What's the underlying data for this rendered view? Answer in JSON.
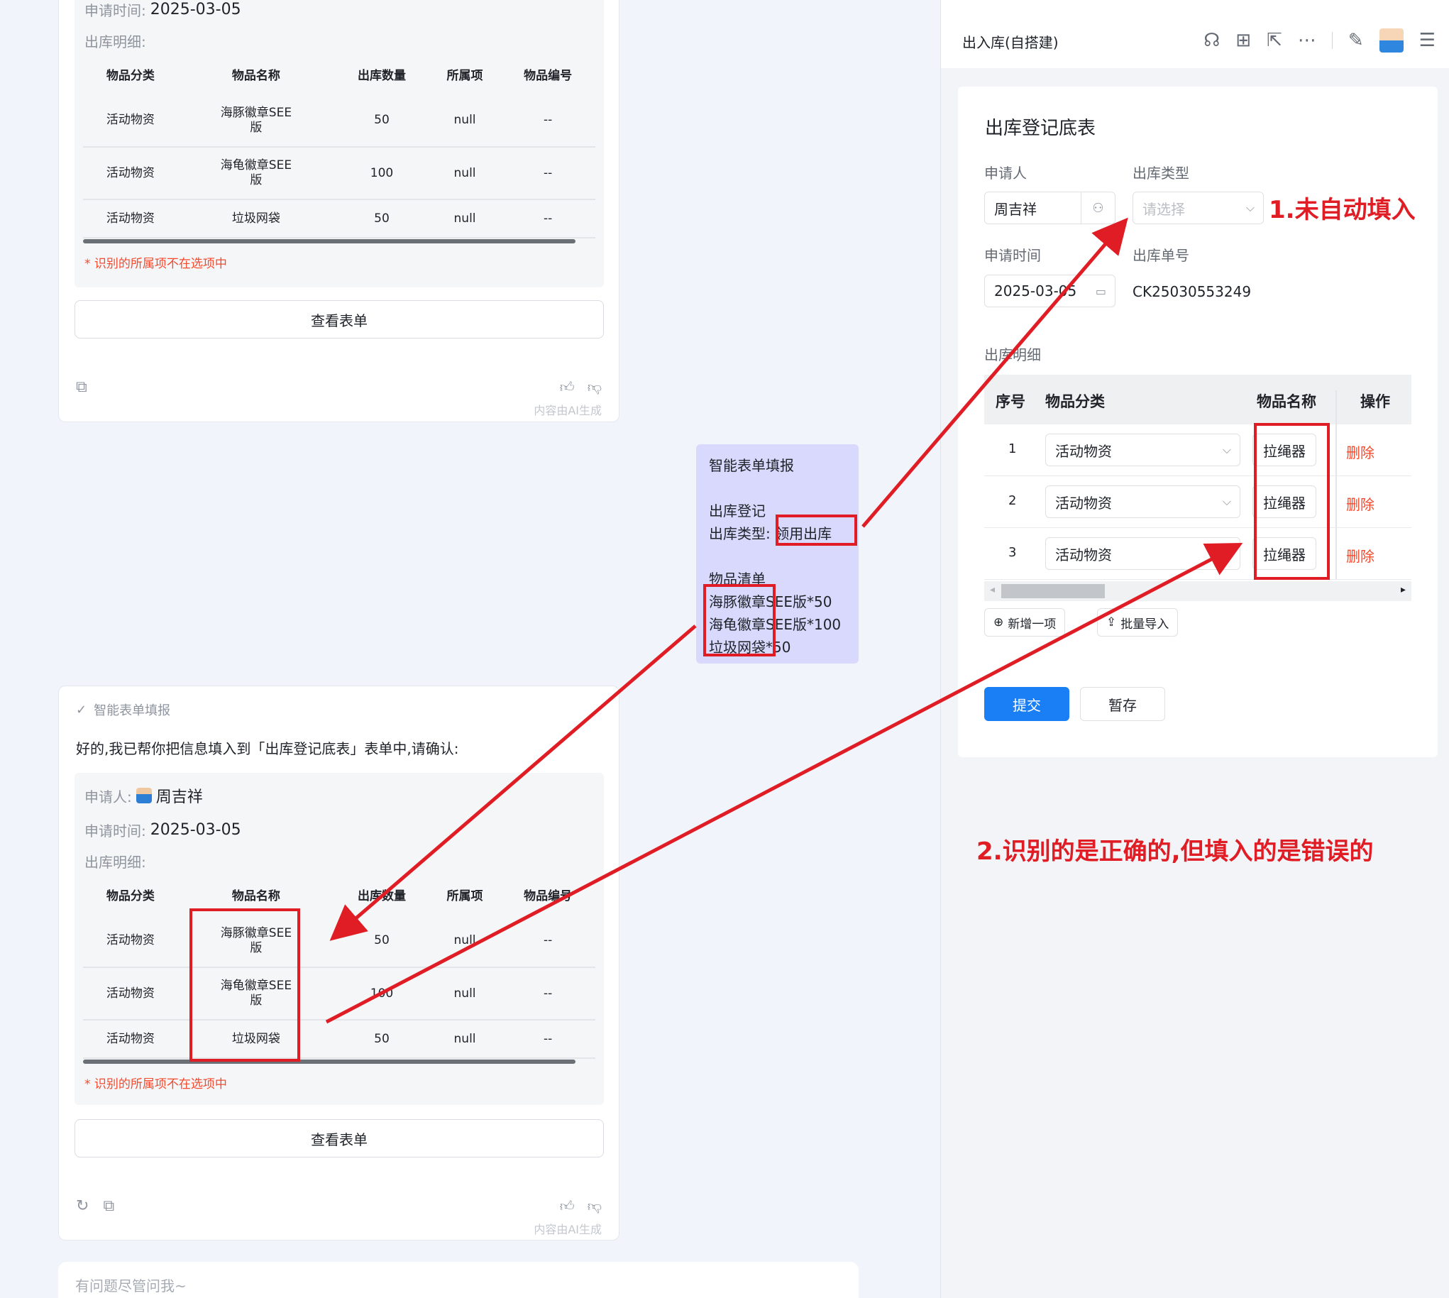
{
  "chat": {
    "card_top": {
      "apply_time_label": "申请时间:",
      "apply_time_value": "2025-03-05",
      "detail_label": "出库明细:",
      "headers": [
        "物品分类",
        "物品名称",
        "出库数量",
        "所属项",
        "物品编号"
      ],
      "rows": [
        [
          "活动物资",
          "海豚徽章SEE版",
          "50",
          "null",
          "--"
        ],
        [
          "活动物资",
          "海龟徽章SEE版",
          "100",
          "null",
          "--"
        ],
        [
          "活动物资",
          "垃圾网袋",
          "50",
          "null",
          "--"
        ]
      ],
      "warning": "* 识别的所属项不在选项中",
      "view_button": "查看表单",
      "ai_note": "内容由AI生成"
    },
    "bubble": {
      "title": "智能表单填报",
      "line_form": "出库登记",
      "line_type_label": "出库类型:",
      "line_type_value": "领用出库",
      "items_label": "物品清单",
      "items": [
        "海豚徽章SEE版*50",
        "海龟徽章SEE版*100",
        "垃圾网袋*50"
      ]
    },
    "card_bottom": {
      "head": "智能表单填报",
      "message": "好的,我已帮你把信息填入到「出库登记底表」表单中,请确认:",
      "applicant_label": "申请人:",
      "applicant_value": "周吉祥",
      "apply_time_label": "申请时间:",
      "apply_time_value": "2025-03-05",
      "detail_label": "出库明细:",
      "headers": [
        "物品分类",
        "物品名称",
        "出库数量",
        "所属项",
        "物品编号"
      ],
      "rows": [
        [
          "活动物资",
          "海豚徽章SEE版",
          "50",
          "null",
          "--"
        ],
        [
          "活动物资",
          "海龟徽章SEE版",
          "100",
          "null",
          "--"
        ],
        [
          "活动物资",
          "垃圾网袋",
          "50",
          "null",
          "--"
        ]
      ],
      "warning": "* 识别的所属项不在选项中",
      "view_button": "查看表单",
      "ai_note": "内容由AI生成"
    },
    "input_placeholder": "有问题尽管问我~"
  },
  "panel": {
    "title": "出入库(自搭建)",
    "form_title": "出库登记底表",
    "applicant_label": "申请人",
    "applicant_value": "周吉祥",
    "type_label": "出库类型",
    "type_placeholder": "请选择",
    "time_label": "申请时间",
    "time_value": "2025-03-05",
    "order_label": "出库单号",
    "order_value": "CK25030553249",
    "detail_label": "出库明细",
    "grid_headers": {
      "idx": "序号",
      "category": "物品分类",
      "name": "物品名称",
      "op": "操作"
    },
    "grid_rows": [
      {
        "idx": "1",
        "category": "活动物资",
        "name": "拉绳器",
        "op": "删除"
      },
      {
        "idx": "2",
        "category": "活动物资",
        "name": "拉绳器",
        "op": "删除"
      },
      {
        "idx": "3",
        "category": "活动物资",
        "name": "拉绳器",
        "op": "删除"
      }
    ],
    "add_button": "新增一项",
    "import_button": "批量导入",
    "submit_button": "提交",
    "draft_button": "暂存"
  },
  "annotations": {
    "note1": "1.未自动填入",
    "note2": "2.识别的是正确的,但填入的是错误的"
  },
  "colors": {
    "accent": "#1a7ef5",
    "danger": "#f5492c",
    "annotation": "#e01c24",
    "bubble": "#d8d9fc"
  }
}
